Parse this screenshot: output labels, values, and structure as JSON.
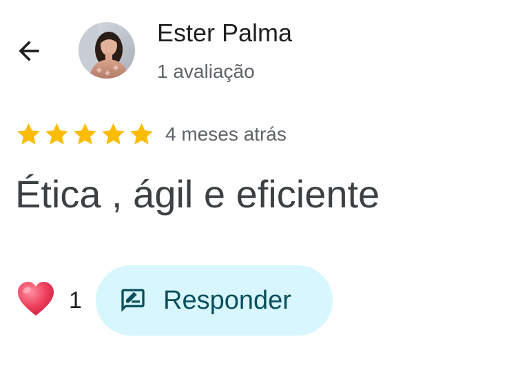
{
  "header": {
    "back_icon": "arrow-left-icon",
    "author_name": "Ester Palma",
    "review_count": "1 avaliação",
    "avatar": "profile-photo"
  },
  "review": {
    "rating": 5,
    "rating_max": 5,
    "date": "4 meses atrás",
    "text": "Ética , ágil e eficiente"
  },
  "actions": {
    "reaction_icon": "heart-icon",
    "reaction_count": "1",
    "reply_icon": "reply-icon",
    "reply_label": "Responder"
  },
  "colors": {
    "star": "#fbbc04",
    "reply_background": "#d7f6fd",
    "reply_text": "#0b4f5c",
    "heart": "#ef3f5d"
  }
}
